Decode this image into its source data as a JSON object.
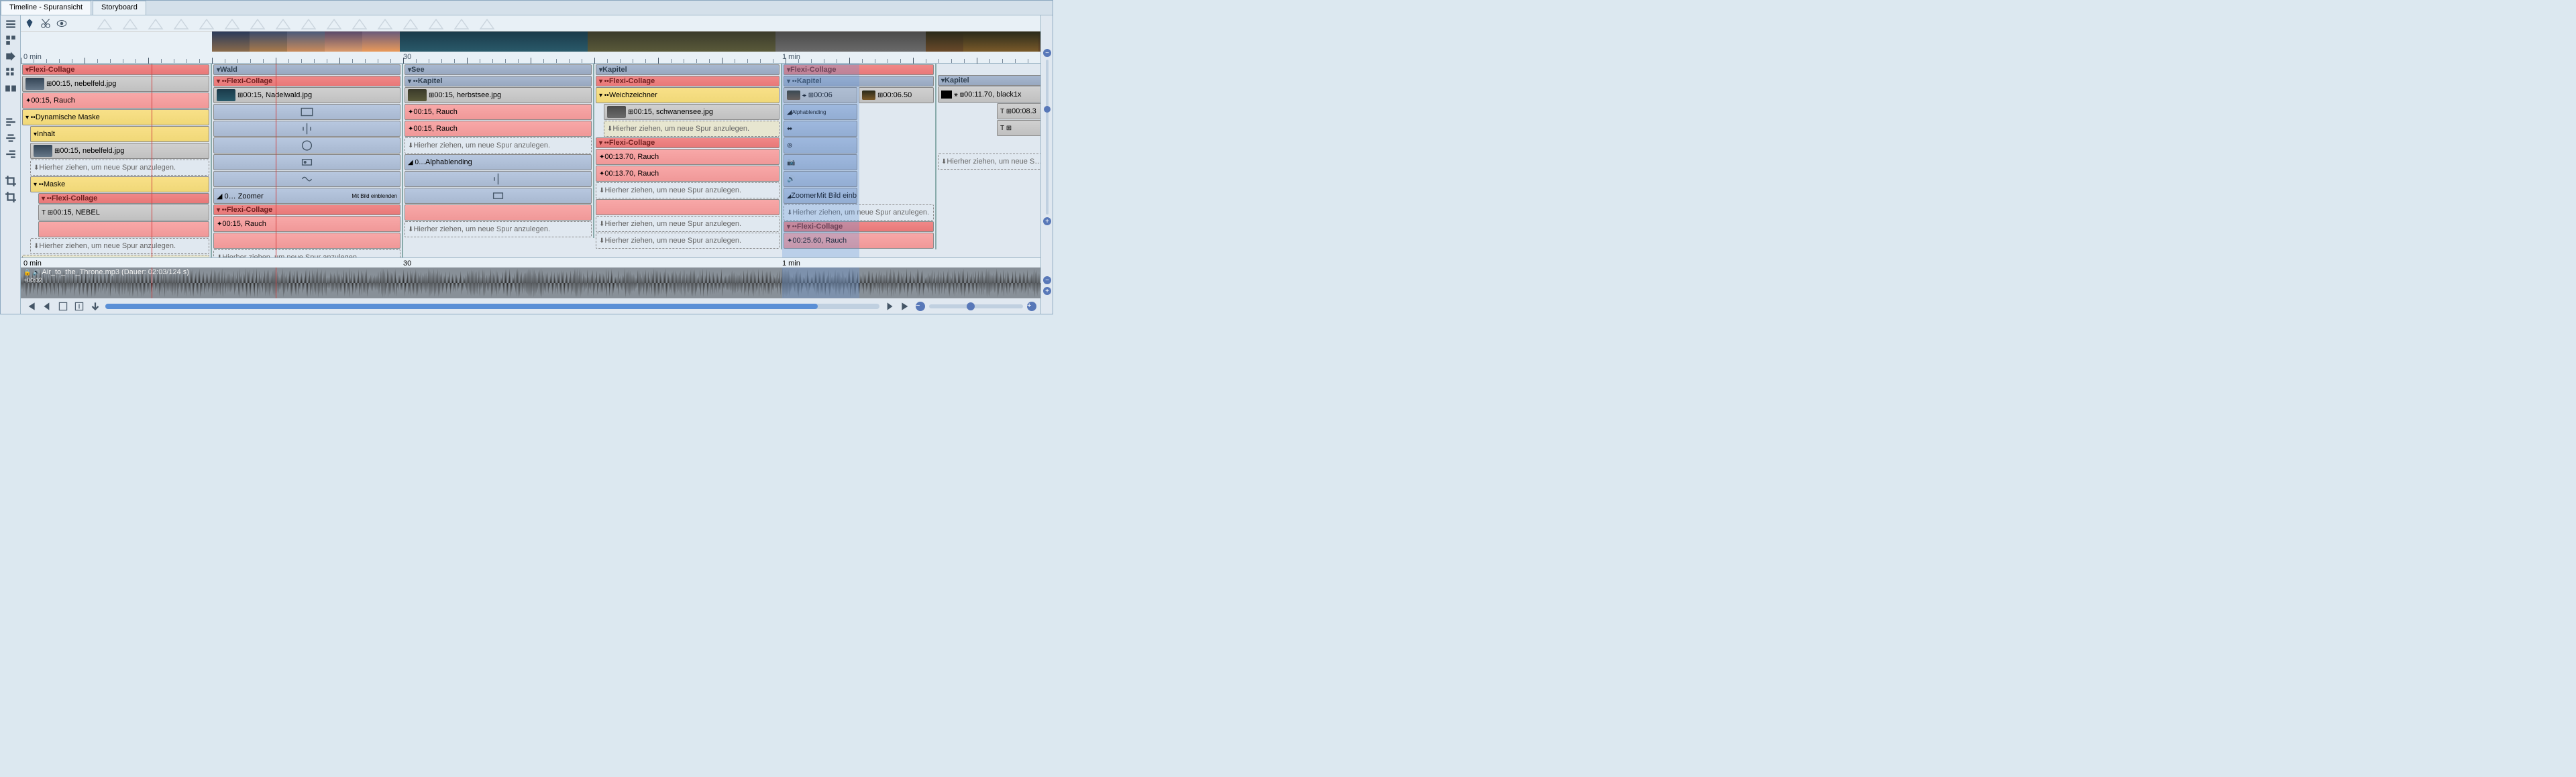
{
  "tabs": {
    "timeline": "Timeline - Spuransicht",
    "storyboard": "Storyboard"
  },
  "ruler": {
    "start": "0 min",
    "mid": "30",
    "end": "1 min"
  },
  "dropHint": "Hierher ziehen, um neue Spur anzulegen.",
  "dropHintShort": "Hierher ziehen, um neue S…",
  "labels": {
    "flexiCollage": "Flexi-Collage",
    "wald": "Wald",
    "see": "See",
    "kapitel": "Kapitel",
    "dynMaske": "Dynamische Maske",
    "inhalt": "Inhalt",
    "maske": "Maske",
    "weichzeichner": "Weichzeichner",
    "rauch": "Rauch",
    "nebel": "NEBEL",
    "alphablending": "Alphablending",
    "zoomer": "Zoomer",
    "mitBild": "Mit Bild einblenden"
  },
  "clips": {
    "nebelfeld": "00:15, nebelfeld.jpg",
    "nebelfeld2": "00:15, nebelfeld.jpg",
    "nadelwald": "00:15, Nadelwald.jpg",
    "herbstsee": "00:15, herbstsee.jpg",
    "schwanensee": "00:15, schwanensee.jpg",
    "rauch15": "00:15, Rauch",
    "rauch1370": "00:13.70, Rauch",
    "rauch2560": "00:25.60, Rauch",
    "nebel15": "00:15, NEBEL",
    "t0006": "00:06",
    "t000650": "00:06.50",
    "black": "00:11.70, black1x",
    "t0083": "00:08.3"
  },
  "audio": {
    "filename": "Air_to_the_Throne.mp3 (Dauer: 02:03/124 s)",
    "offset": "+00:02",
    "start": "0 min",
    "mid": "30",
    "end": "1 min"
  },
  "thumbGradients": [
    "linear-gradient(#2a3a5a,#8a6a4a)",
    "linear-gradient(#3a4a6a,#aa7a4a)",
    "linear-gradient(#4a5a7a,#ca8a5a)",
    "linear-gradient(#5a4a6a,#da9a6a)",
    "linear-gradient(#6a5a7a,#ea9a5a)",
    "linear-gradient(#1a3a4a,#2a5a6a)",
    "linear-gradient(#1a3a4a,#2a5a6a)",
    "linear-gradient(#1a3a4a,#2a5a6a)",
    "linear-gradient(#1a3a4a,#2a5a6a)",
    "linear-gradient(#1a3a4a,#2a5a6a)",
    "linear-gradient(#3a3a2a,#5a5a3a)",
    "linear-gradient(#3a3a2a,#5a5a3a)",
    "linear-gradient(#3a3a2a,#5a5a3a)",
    "linear-gradient(#3a3a2a,#5a5a3a)",
    "linear-gradient(#3a3a2a,#5a5a3a)",
    "linear-gradient(#4a4a4a,#6a6a6a)",
    "linear-gradient(#4a4a4a,#6a6a6a)",
    "linear-gradient(#4a4a4a,#6a6a6a)",
    "linear-gradient(#4a4a4a,#6a6a6a)",
    "linear-gradient(#2a2a1a,#6a4a2a)",
    "linear-gradient(#2a2a1a,#7a5a2a)",
    "linear-gradient(#2a2a1a,#7a5a2a)",
    "linear-gradient(#2a2a1a,#6a4a2a)",
    "linear-gradient(#2a2a1a,#6a4a2a)",
    "linear-gradient(#2a2a1a,#6a4a2a)",
    "linear-gradient(#2a2a1a,#6a4a2a)",
    "linear-gradient(#2a2a1a,#6a4a2a)",
    "linear-gradient(#2a2a1a,#6a4a2a)"
  ]
}
